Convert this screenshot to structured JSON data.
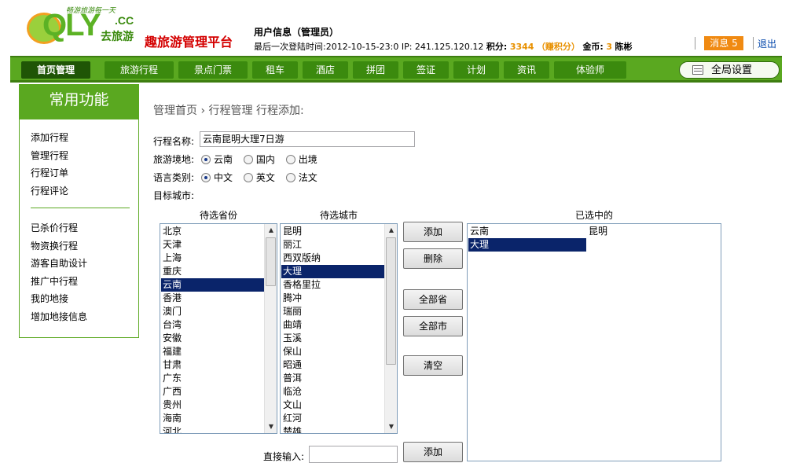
{
  "logo": {
    "slogan": "畅游旅游每一天",
    "letters": "QLY",
    "cc": ".CC",
    "cn": "去旅游"
  },
  "header": {
    "site_title": "趣旅游管理平台",
    "user_title": "用户信息（管理员）",
    "last_login_label": "最后一次登陆时间:",
    "last_login_time": "2012-10-15-23:0",
    "ip_label": "IP:",
    "ip": "241.125.120.12",
    "points_label": "积分:",
    "points_value": "3344",
    "earn_points": "（赚积分）",
    "coins_label": "金币:",
    "coins_value": "3",
    "username": "陈彬",
    "messages": "消息 5",
    "logout": "退出"
  },
  "nav": {
    "items": [
      "首页管理",
      "旅游行程",
      "景点门票",
      "租车",
      "酒店",
      "拼团",
      "签证",
      "计划",
      "资讯",
      "体验师"
    ],
    "settings": "全局设置"
  },
  "sidebar": {
    "title": "常用功能",
    "group1": [
      "添加行程",
      "管理行程",
      "行程订单",
      "行程评论"
    ],
    "group2": [
      "已杀价行程",
      "物资换行程",
      "游客自助设计",
      "推广中行程",
      "我的地接",
      "增加地接信息"
    ]
  },
  "breadcrumb": "管理首页 › 行程管理  行程添加:",
  "form": {
    "name_label": "行程名称:",
    "name_value": "云南昆明大理7日游",
    "region_label": "旅游境地:",
    "region_options": [
      "云南",
      "国内",
      "出境"
    ],
    "region_checked": 0,
    "lang_label": "语言类别:",
    "lang_options": [
      "中文",
      "英文",
      "法文"
    ],
    "lang_checked": 0,
    "target_label": "目标城市:",
    "province_header": "待选省份",
    "city_header": "待选城市",
    "selected_header": "已选中的",
    "provinces": [
      "北京",
      "天津",
      "上海",
      "重庆",
      "云南",
      "香港",
      "澳门",
      "台湾",
      "安徽",
      "福建",
      "甘肃",
      "广东",
      "广西",
      "贵州",
      "海南",
      "河北"
    ],
    "province_selected": 4,
    "cities": [
      "昆明",
      "丽江",
      "西双版纳",
      "大理",
      "香格里拉",
      "腾冲",
      "瑞丽",
      "曲靖",
      "玉溪",
      "保山",
      "昭通",
      "普洱",
      "临沧",
      "文山",
      "红河",
      "楚雄"
    ],
    "city_selected": 3,
    "selected": [
      {
        "province": "云南",
        "city": "昆明"
      },
      {
        "province": "大理",
        "city": ""
      }
    ],
    "buttons": {
      "add": "添加",
      "delete": "删除",
      "all_provinces": "全部省",
      "all_cities": "全部市",
      "clear": "清空",
      "add2": "添加"
    },
    "direct_input_label": "直接输入:",
    "direct_input_value": ""
  }
}
